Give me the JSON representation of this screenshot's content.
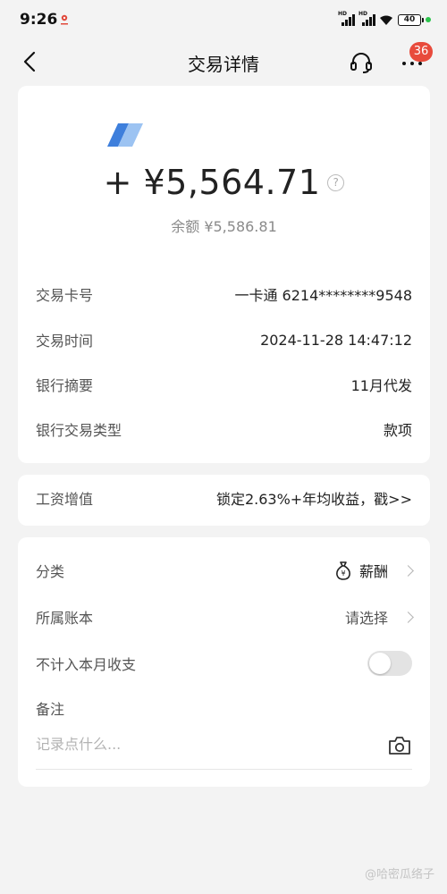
{
  "status_bar": {
    "time": "9:26",
    "battery": "40"
  },
  "nav": {
    "title": "交易详情",
    "badge": "36"
  },
  "transaction": {
    "amount": "+ ¥5,564.71",
    "balance": "余额 ¥5,586.81",
    "help_label": "?",
    "details": [
      {
        "label": "交易卡号",
        "value": "一卡通 6214********9548"
      },
      {
        "label": "交易时间",
        "value": "2024-11-28 14:47:12"
      },
      {
        "label": "银行摘要",
        "value": "11月代发"
      },
      {
        "label": "银行交易类型",
        "value": "款项"
      }
    ]
  },
  "promo": {
    "label": "工资增值",
    "value": "锁定2.63%+年均收益，戳>>"
  },
  "extra": {
    "category_label": "分类",
    "category_value": "薪酬",
    "account_label": "所属账本",
    "account_value": "请选择",
    "exclude_label": "不计入本月收支",
    "exclude_enabled": false,
    "note_label": "备注",
    "note_placeholder": "记录点什么..."
  },
  "watermark": "@哈密瓜络子",
  "colors": {
    "badge": "#e84b3c",
    "logo_blue": "#3e7fdc",
    "toggle_off": "#e3e3e3"
  }
}
